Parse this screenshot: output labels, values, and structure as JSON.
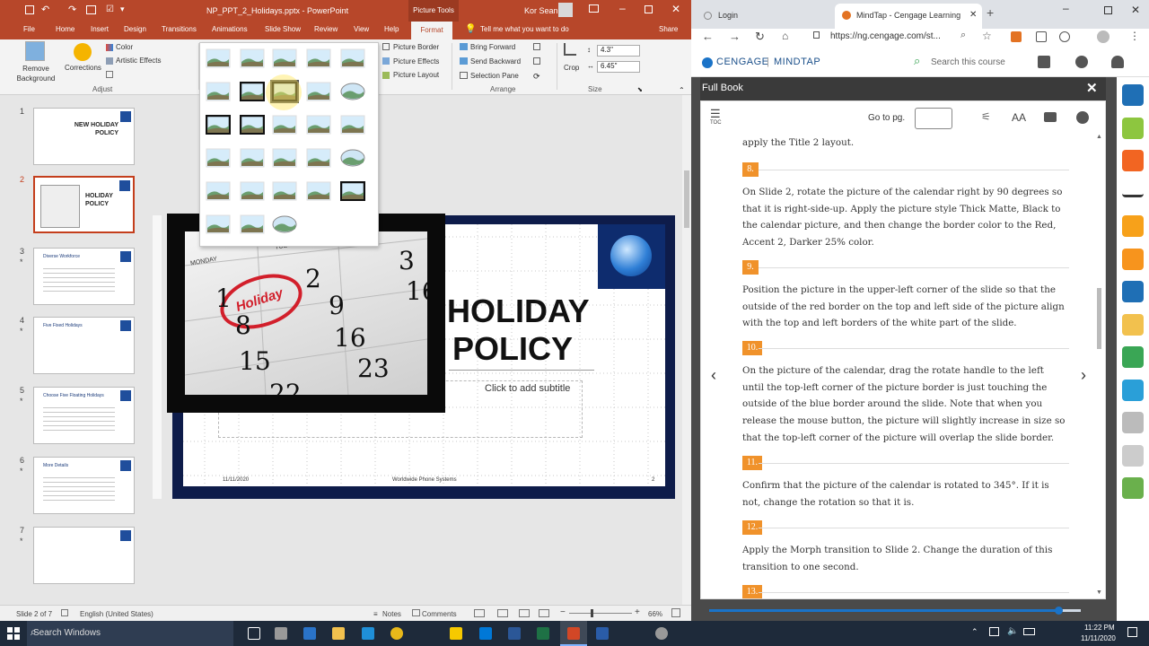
{
  "ppt": {
    "file_title": "NP_PPT_2_Holidays.pptx - PowerPoint",
    "picture_tools": "Picture Tools",
    "user": "Kor Sean",
    "tabs": [
      "File",
      "Home",
      "Insert",
      "Design",
      "Transitions",
      "Animations",
      "Slide Show",
      "Review",
      "View",
      "Help",
      "Format"
    ],
    "tell_me": "Tell me what you want to do",
    "share": "Share",
    "ribbon": {
      "remove_bg": "Remove Background",
      "corrections": "Corrections",
      "color": "Color",
      "artistic": "Artistic Effects",
      "adjust": "Adjust",
      "pic_border": "Picture Border",
      "pic_effects": "Picture Effects",
      "pic_layout": "Picture Layout",
      "bring_forward": "Bring Forward",
      "send_backward": "Send Backward",
      "selection_pane": "Selection Pane",
      "arrange": "Arrange",
      "crop": "Crop",
      "height": "4.3\"",
      "width": "6.45\"",
      "size": "Size"
    },
    "thumbs": [
      {
        "num": "1",
        "title": "NEW HOLIDAY POLICY"
      },
      {
        "num": "2",
        "title": "HOLIDAY POLICY"
      },
      {
        "num": "3",
        "title": "Diverse Workforce",
        "star": "*"
      },
      {
        "num": "4",
        "title": "Five Fixed Holidays",
        "star": "*"
      },
      {
        "num": "5",
        "title": "Choose Five Floating Holidays",
        "star": "*"
      },
      {
        "num": "6",
        "title": "More Details",
        "star": "*"
      },
      {
        "num": "7",
        "title": "",
        "star": "*"
      }
    ],
    "slide": {
      "title_line1": "HOLIDAY",
      "title_line2": "POLICY",
      "subtitle": "Click to add subtitle",
      "footer_date": "11/11/2020",
      "footer_company": "Worldwide Phone Systems",
      "footer_page": "2",
      "calendar": {
        "day1": "MONDAY",
        "day2": "TUESDAY",
        "nums": [
          "1",
          "2",
          "3",
          "8",
          "9",
          "16",
          "15",
          "16",
          "23",
          "22"
        ],
        "holiday": "Holiday"
      }
    },
    "status": {
      "slide_of": "Slide 2 of 7",
      "language": "English (United States)",
      "notes": "Notes",
      "comments": "Comments",
      "zoom": "66%"
    }
  },
  "browser": {
    "tabs": [
      {
        "label": "Login"
      },
      {
        "label": "MindTap - Cengage Learning"
      }
    ],
    "url": "https://ng.cengage.com/st...",
    "brand": "CENGAGE",
    "product": "MINDTAP",
    "search_placeholder": "Search this course",
    "panel_title": "Full Book",
    "toc": "TOC",
    "goto": "Go to pg.",
    "font_size": "AA",
    "intro": "apply the Title 2 layout.",
    "steps": [
      {
        "num": "8.",
        "text": "On Slide 2, rotate the picture of the calendar right by 90 degrees so that it is right-side-up. Apply the picture style Thick Matte, Black to the calendar picture, and then change the border color to the Red, Accent 2, Darker 25% color."
      },
      {
        "num": "9.",
        "text": "Position the picture in the upper-left corner of the slide so that the outside of the red border on the top and left side of the picture align with the top and left borders of the white part of the slide."
      },
      {
        "num": "10.",
        "text": "On the picture of the calendar, drag the rotate handle to the left until the top-left corner of the picture border is just touching the outside of the blue border around the slide. Note that when you release the mouse button, the picture will slightly increase in size so that the top-left corner of the picture will overlap the slide border."
      },
      {
        "num": "11.",
        "text": "Confirm that the picture of the calendar is rotated to 345°. If it is not, change the rotation so that it is."
      },
      {
        "num": "12.",
        "text": "Apply the Morph transition to Slide 2. Change the duration of this transition to one second."
      },
      {
        "num": "13.",
        "text": ""
      }
    ],
    "progress": 0.94
  },
  "taskbar": {
    "search": "Search Windows",
    "time": "11:22 PM",
    "date": "11/11/2020"
  },
  "colors": {
    "ppt_accent": "#b7472a",
    "slide_border": "#0e1c4a",
    "step_badge": "#f0922b",
    "progress": "#1a73c8"
  }
}
